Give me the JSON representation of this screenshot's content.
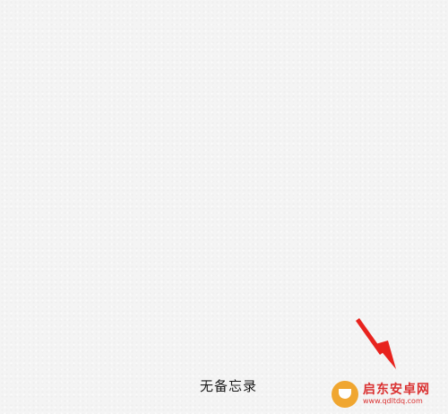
{
  "notes": {
    "empty_message": "无备忘录"
  },
  "watermark": {
    "name": "启东安卓网",
    "url": "www.qdltdq.com"
  },
  "colors": {
    "background": "#f4f4f4",
    "annotation_arrow": "#e8231e",
    "watermark_red": "#d82020"
  }
}
